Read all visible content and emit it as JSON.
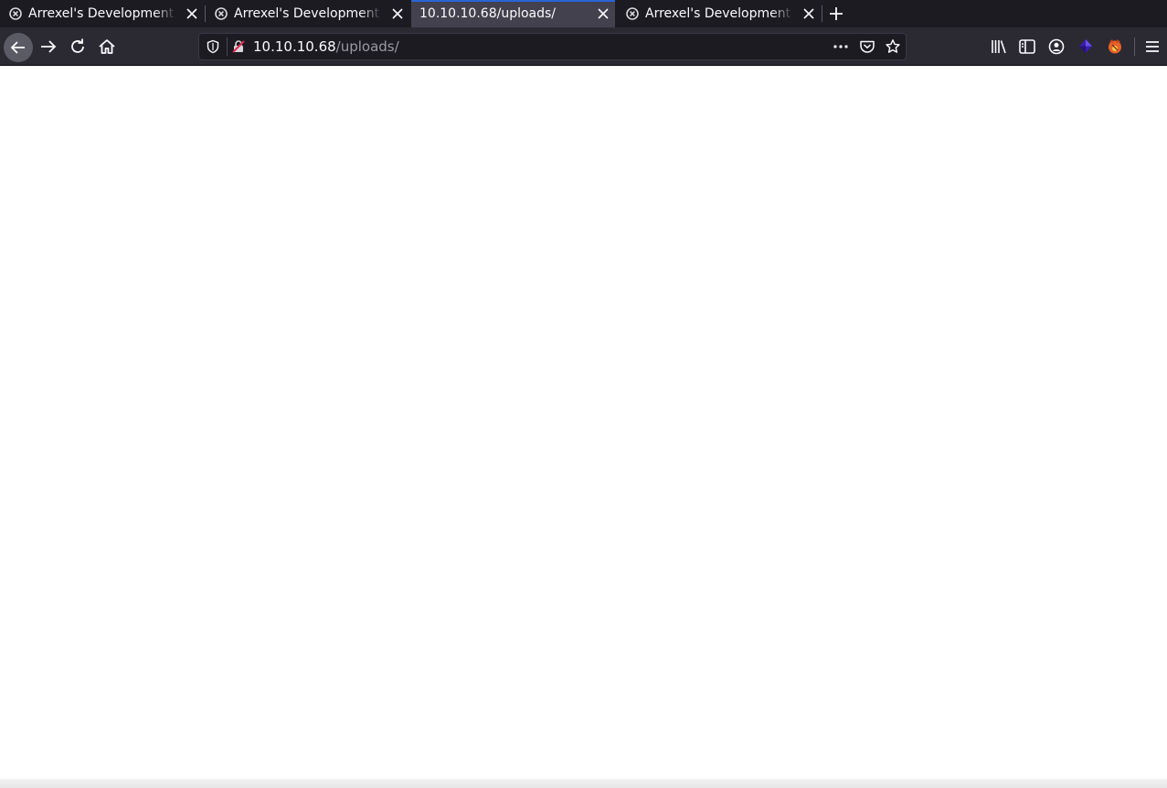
{
  "browser": {
    "tabs": [
      {
        "title": "Arrexel's Development Site",
        "icon": "drupal-favicon-icon",
        "active": false
      },
      {
        "title": "Arrexel's Development Site",
        "icon": "drupal-favicon-icon",
        "active": false
      },
      {
        "title": "10.10.10.68/uploads/",
        "icon": "",
        "active": true
      },
      {
        "title": "Arrexel's Development Site",
        "icon": "drupal-favicon-icon",
        "active": false
      }
    ],
    "url": {
      "host": "10.10.10.68",
      "path": "/uploads/"
    },
    "toolbar_icons": [
      "back-arrow-icon",
      "forward-arrow-icon",
      "reload-icon",
      "home-icon",
      "tracking-shield-icon",
      "insecure-lock-icon",
      "page-actions-icon",
      "pocket-icon",
      "bookmark-star-icon",
      "library-icon",
      "sidebar-icon",
      "account-icon",
      "extension-icon",
      "foxyproxy-icon",
      "menu-icon"
    ],
    "colors": {
      "tabbar_bg": "#1c1b22",
      "active_tab_bg": "#42414d",
      "active_tab_accent": "#2a63d6",
      "navbar_bg": "#2b2a33",
      "urlbar_bg": "#1c1b22",
      "page_bg": "#ffffff"
    }
  }
}
